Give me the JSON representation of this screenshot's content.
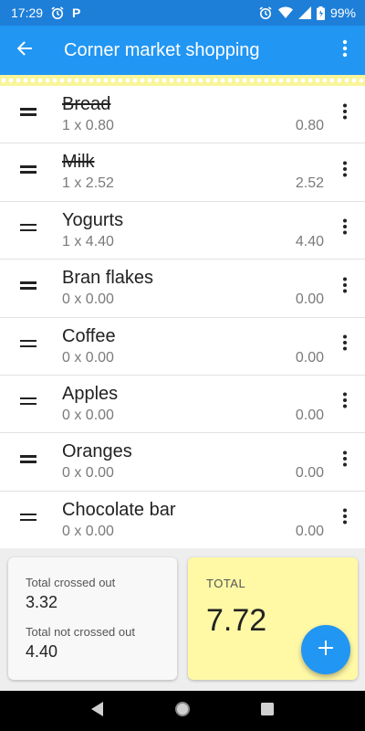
{
  "status_bar": {
    "time": "17:29",
    "parking_badge": "P",
    "battery": "99%",
    "icons": [
      "alarm-icon",
      "alarm-icon",
      "wifi-icon",
      "signal-icon",
      "battery-icon"
    ]
  },
  "app_bar": {
    "title": "Corner market shopping",
    "back_icon": "arrow-left-icon",
    "menu_icon": "more-vert-icon"
  },
  "items": [
    {
      "name": "Bread",
      "qty": "1 x 0.80",
      "price": "0.80",
      "crossed": true
    },
    {
      "name": "Milk",
      "qty": "1 x 2.52",
      "price": "2.52",
      "crossed": true
    },
    {
      "name": "Yogurts",
      "qty": "1 x 4.40",
      "price": "4.40",
      "crossed": false
    },
    {
      "name": "Bran flakes",
      "qty": "0 x 0.00",
      "price": "0.00",
      "crossed": false
    },
    {
      "name": "Coffee",
      "qty": "0 x 0.00",
      "price": "0.00",
      "crossed": false
    },
    {
      "name": "Apples",
      "qty": "0 x 0.00",
      "price": "0.00",
      "crossed": false
    },
    {
      "name": "Oranges",
      "qty": "0 x 0.00",
      "price": "0.00",
      "crossed": false
    },
    {
      "name": "Chocolate bar",
      "qty": "0 x 0.00",
      "price": "0.00",
      "crossed": false
    }
  ],
  "summary": {
    "crossed_label": "Total crossed out",
    "crossed_value": "3.32",
    "not_crossed_label": "Total not crossed out",
    "not_crossed_value": "4.40",
    "total_label": "TOTAL",
    "total_value": "7.72"
  },
  "fab_icon": "plus-icon",
  "nav": [
    "back-triangle-icon",
    "home-circle-icon",
    "recents-square-icon"
  ],
  "colors": {
    "primary": "#2196f3",
    "status_bar": "#1e7fd8",
    "total_card": "#fff9a6",
    "deco_strip": "#f9f59a"
  }
}
